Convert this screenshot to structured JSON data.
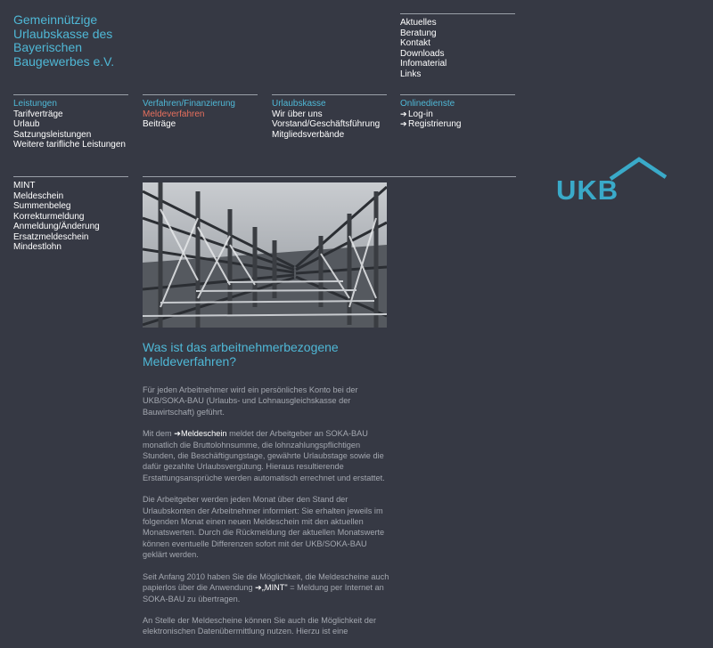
{
  "org": {
    "title_lines": [
      "Gemeinnützige",
      "Urlaubskasse des",
      "Bayerischen",
      "Baugewerbes e.V."
    ]
  },
  "utility_nav": [
    "Aktuelles",
    "Beratung",
    "Kontakt",
    "Downloads",
    "Infomaterial",
    "Links"
  ],
  "main_nav": {
    "leistungen": {
      "head": "Leistungen",
      "items": [
        "Tarifverträge",
        "Urlaub",
        "Satzungsleistungen",
        "Weitere tarifliche Leistungen"
      ]
    },
    "verfahren": {
      "head": "Verfahren/Finanzierung",
      "active": "Meldeverfahren",
      "items": [
        "Beiträge"
      ]
    },
    "urlaubskasse": {
      "head": "Urlaubskasse",
      "items": [
        "Wir über uns",
        "Vorstand/Geschäftsführung",
        "Mitgliedsverbände"
      ]
    },
    "onlinedienste": {
      "head": "Onlinedienste",
      "items": [
        "Log-in",
        "Registrierung"
      ],
      "arrow": "➔"
    }
  },
  "side_nav": [
    "MINT",
    "Meldeschein",
    "Summenbeleg",
    "Korrekturmeldung",
    "Anmeldung/Änderung",
    "Ersatzmeldeschein",
    "Mindestlohn"
  ],
  "logo": {
    "text": "UKB",
    "color": "#3aaac9"
  },
  "colors": {
    "background": "#363944",
    "accent": "#4fb8d6",
    "active": "#e8705e",
    "body_text": "#a4a8b0"
  },
  "article": {
    "title": "Was ist das arbeitnehmerbezogene Meldeverfahren?",
    "p1": "Für jeden Arbeitnehmer wird ein persönliches Konto bei der UKB/SOKA-BAU (Urlaubs- und Lohnausgleichskasse der Bauwirtschaft) geführt.",
    "p2_before": "Mit dem ",
    "p2_link": "Meldeschein",
    "p2_after": " meldet der Arbeitgeber an SOKA-BAU monatlich die Bruttolohnsumme, die lohnzahlungspflichtigen Stunden, die Beschäftigungstage, gewährte Urlaubstage sowie die dafür gezahlte Urlaubsvergütung. Hieraus resultierende Erstattungsansprüche werden automatisch errechnet und erstattet.",
    "p3": "Die Arbeitgeber werden jeden Monat über den Stand der Urlaubskonten der Arbeitnehmer informiert: Sie erhalten jeweils im folgenden Monat einen neuen Meldeschein mit den aktuellen Monatswerten. Durch die Rückmeldung der aktuellen Monatswerte können eventuelle Differenzen sofort mit der UKB/SOKA-BAU geklärt werden.",
    "p4_before": "Seit Anfang 2010 haben Sie die Möglichkeit, die Meldescheine auch papierlos über die Anwendung ",
    "p4_link": "„MINT\"",
    "p4_after": " = Meldung per Internet an SOKA-BAU zu übertragen.",
    "p5": "An Stelle der Meldescheine können Sie auch die Möglichkeit der elektronischen Datenübermittlung nutzen. Hierzu ist eine",
    "arrow": "➔"
  }
}
